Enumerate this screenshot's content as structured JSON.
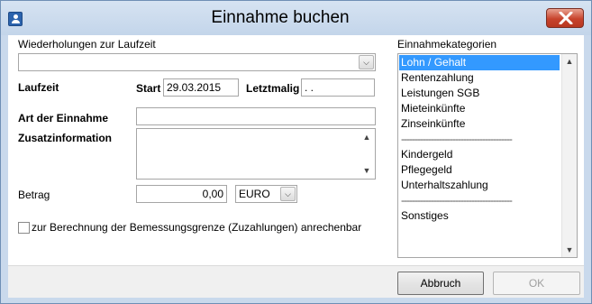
{
  "window": {
    "title": "Einnahme buchen"
  },
  "form": {
    "wiederholungen_label": "Wiederholungen zur Laufzeit",
    "wiederholungen_value": "",
    "laufzeit_label": "Laufzeit",
    "start_label": "Start",
    "start_value": "29.03.2015",
    "letztmalig_label": "Letztmalig",
    "letztmalig_value": " .  .",
    "art_label": "Art der Einnahme",
    "art_value": "",
    "zusatz_label": "Zusatzinformation",
    "zusatz_value": "",
    "betrag_label": "Betrag",
    "betrag_value": "0,00",
    "currency_value": "EURO",
    "checkbox_label": "zur Berechnung der Bemessungsgrenze (Zuzahlungen) anrechenbar",
    "checkbox_checked": false
  },
  "categories": {
    "label": "Einnahmekategorien",
    "items": [
      {
        "label": "Lohn / Gehalt",
        "selected": true
      },
      {
        "label": "Rentenzahlung"
      },
      {
        "label": "Leistungen SGB"
      },
      {
        "label": "Mieteinkünfte"
      },
      {
        "label": "Zinseinkünfte"
      },
      {
        "label": "-----------------------------------------",
        "separator": true
      },
      {
        "label": "Kindergeld"
      },
      {
        "label": "Pflegegeld"
      },
      {
        "label": "Unterhaltszahlung"
      },
      {
        "label": "-----------------------------------------",
        "separator": true
      },
      {
        "label": "Sonstiges"
      }
    ]
  },
  "buttons": {
    "cancel": "Abbruch",
    "ok": "OK"
  },
  "icons": {
    "app": "user-icon",
    "close": "close-icon",
    "dropdown": "chevron-down-icon",
    "scroll_up": "chevron-up-icon"
  },
  "colors": {
    "selection": "#3399ff",
    "close_button": "#c7432c",
    "title_bar": "#c9d9ec"
  }
}
